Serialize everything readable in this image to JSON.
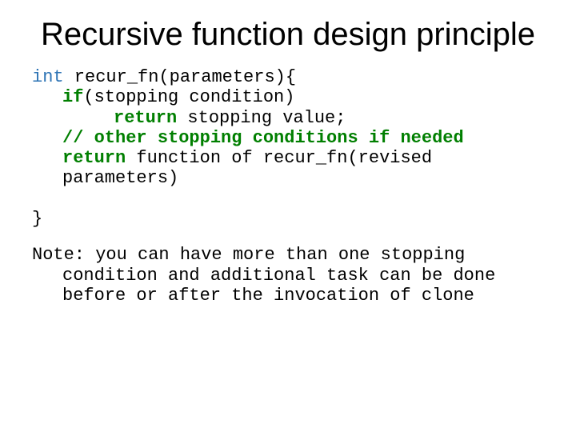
{
  "title": "Recursive function design principle",
  "code": {
    "kw_int": "int",
    "fn_sig": " recur_fn(parameters){",
    "kw_if": "if",
    "if_cond": "(stopping condition)",
    "kw_return1": "return",
    "ret_val": " stopping value;",
    "comment": "// other stopping conditions if needed",
    "kw_return2": "return",
    "ret_expr1": " function of recur_fn(revised",
    "ret_expr2": "parameters)",
    "close": "}"
  },
  "note": {
    "l1": "Note: you can have more than one stopping",
    "l2": "condition and additional task can be done",
    "l3": "before or after the invocation of clone"
  }
}
